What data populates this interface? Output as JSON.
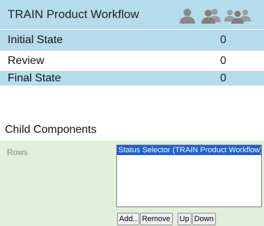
{
  "workflow": {
    "title": "TRAIN Product Workflow",
    "header_icons": [
      "single-user-icon",
      "two-users-icon",
      "three-users-icon"
    ],
    "rows": [
      {
        "state": "Initial State",
        "count": "0"
      },
      {
        "state": "Review",
        "count": "0"
      },
      {
        "state": "Final State",
        "count": "0"
      }
    ]
  },
  "child_components": {
    "title": "Child Components",
    "rows_label": "Rows",
    "selected_item": "Status Selector (TRAIN Product Workflow)",
    "buttons": {
      "add": "Add..",
      "remove": "Remove",
      "up": "Up",
      "down": "Down"
    }
  },
  "colors": {
    "header_blue": "#b5dcec",
    "panel_green": "#e2efda",
    "selection_blue": "#1e5fd6"
  }
}
